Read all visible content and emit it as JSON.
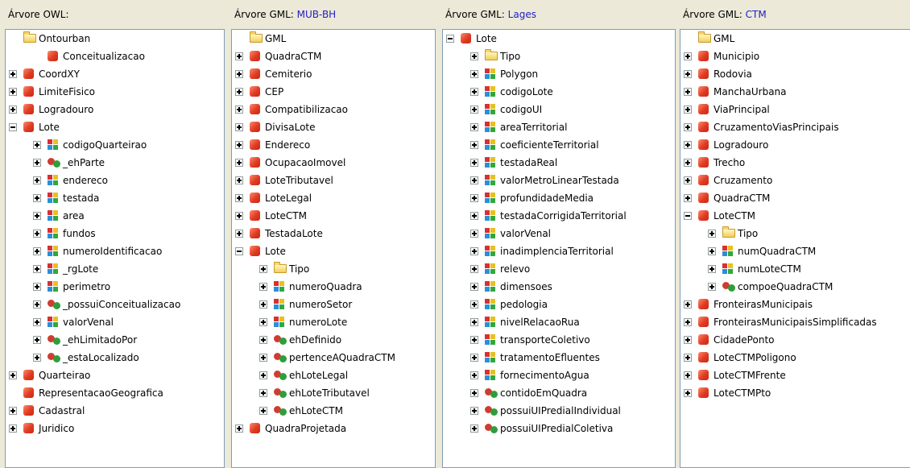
{
  "panels": [
    {
      "header": "Árvore OWL:",
      "source": "",
      "rows": [
        {
          "depth": 0,
          "toggle": "none",
          "icon": "folder",
          "label": "Ontourban"
        },
        {
          "depth": 1,
          "toggle": "none",
          "icon": "class",
          "label": "Conceitualizacao"
        },
        {
          "depth": 0,
          "toggle": "plus",
          "icon": "class",
          "label": "CoordXY"
        },
        {
          "depth": 0,
          "toggle": "plus",
          "icon": "class",
          "label": "LimiteFisico"
        },
        {
          "depth": 0,
          "toggle": "plus",
          "icon": "class",
          "label": "Logradouro"
        },
        {
          "depth": 0,
          "toggle": "minus",
          "icon": "class",
          "label": "Lote"
        },
        {
          "depth": 1,
          "toggle": "plus",
          "icon": "dt",
          "label": "codigoQuarteirao"
        },
        {
          "depth": 1,
          "toggle": "plus",
          "icon": "obj",
          "label": "_ehParte"
        },
        {
          "depth": 1,
          "toggle": "plus",
          "icon": "dt",
          "label": "endereco"
        },
        {
          "depth": 1,
          "toggle": "plus",
          "icon": "dt",
          "label": "testada"
        },
        {
          "depth": 1,
          "toggle": "plus",
          "icon": "dt",
          "label": "area"
        },
        {
          "depth": 1,
          "toggle": "plus",
          "icon": "dt",
          "label": "fundos"
        },
        {
          "depth": 1,
          "toggle": "plus",
          "icon": "dt",
          "label": "numeroIdentificacao"
        },
        {
          "depth": 1,
          "toggle": "plus",
          "icon": "dt",
          "label": "_rgLote"
        },
        {
          "depth": 1,
          "toggle": "plus",
          "icon": "dt",
          "label": "perimetro"
        },
        {
          "depth": 1,
          "toggle": "plus",
          "icon": "obj",
          "label": "_possuiConceitualizacao"
        },
        {
          "depth": 1,
          "toggle": "plus",
          "icon": "dt",
          "label": "valorVenal"
        },
        {
          "depth": 1,
          "toggle": "plus",
          "icon": "obj",
          "label": "_ehLimitadoPor"
        },
        {
          "depth": 1,
          "toggle": "plus",
          "icon": "obj",
          "label": "_estaLocalizado"
        },
        {
          "depth": 0,
          "toggle": "plus",
          "icon": "class",
          "label": "Quarteirao"
        },
        {
          "depth": 0,
          "toggle": "none",
          "icon": "class",
          "label": "RepresentacaoGeografica"
        },
        {
          "depth": 0,
          "toggle": "plus",
          "icon": "class",
          "label": "Cadastral"
        },
        {
          "depth": 0,
          "toggle": "plus",
          "icon": "class",
          "label": "Juridico"
        }
      ]
    },
    {
      "header": "Árvore GML:",
      "source": "MUB-BH",
      "rows": [
        {
          "depth": 0,
          "toggle": "none",
          "icon": "folder",
          "label": "GML"
        },
        {
          "depth": 0,
          "toggle": "plus",
          "icon": "class",
          "label": "QuadraCTM"
        },
        {
          "depth": 0,
          "toggle": "plus",
          "icon": "class",
          "label": "Cemiterio"
        },
        {
          "depth": 0,
          "toggle": "plus",
          "icon": "class",
          "label": "CEP"
        },
        {
          "depth": 0,
          "toggle": "plus",
          "icon": "class",
          "label": "Compatibilizacao"
        },
        {
          "depth": 0,
          "toggle": "plus",
          "icon": "class",
          "label": "DivisaLote"
        },
        {
          "depth": 0,
          "toggle": "plus",
          "icon": "class",
          "label": "Endereco"
        },
        {
          "depth": 0,
          "toggle": "plus",
          "icon": "class",
          "label": "OcupacaoImovel"
        },
        {
          "depth": 0,
          "toggle": "plus",
          "icon": "class",
          "label": "LoteTributavel"
        },
        {
          "depth": 0,
          "toggle": "plus",
          "icon": "class",
          "label": "LoteLegal"
        },
        {
          "depth": 0,
          "toggle": "plus",
          "icon": "class",
          "label": "LoteCTM"
        },
        {
          "depth": 0,
          "toggle": "plus",
          "icon": "class",
          "label": "TestadaLote"
        },
        {
          "depth": 0,
          "toggle": "minus",
          "icon": "class",
          "label": "Lote"
        },
        {
          "depth": 1,
          "toggle": "plus",
          "icon": "folder",
          "label": "Tipo"
        },
        {
          "depth": 1,
          "toggle": "plus",
          "icon": "dt",
          "label": "numeroQuadra"
        },
        {
          "depth": 1,
          "toggle": "plus",
          "icon": "dt",
          "label": "numeroSetor"
        },
        {
          "depth": 1,
          "toggle": "plus",
          "icon": "dt",
          "label": "numeroLote"
        },
        {
          "depth": 1,
          "toggle": "plus",
          "icon": "obj",
          "label": "ehDefinido"
        },
        {
          "depth": 1,
          "toggle": "plus",
          "icon": "obj",
          "label": "pertenceAQuadraCTM"
        },
        {
          "depth": 1,
          "toggle": "plus",
          "icon": "obj",
          "label": "ehLoteLegal"
        },
        {
          "depth": 1,
          "toggle": "plus",
          "icon": "obj",
          "label": "ehLoteTributavel"
        },
        {
          "depth": 1,
          "toggle": "plus",
          "icon": "obj",
          "label": "ehLoteCTM"
        },
        {
          "depth": 0,
          "toggle": "plus",
          "icon": "class",
          "label": "QuadraProjetada"
        }
      ]
    },
    {
      "header": "Árvore GML:",
      "source": "Lages",
      "rows": [
        {
          "depth": 0,
          "toggle": "minus",
          "icon": "class",
          "label": "Lote"
        },
        {
          "depth": 1,
          "toggle": "plus",
          "icon": "folder",
          "label": "Tipo"
        },
        {
          "depth": 1,
          "toggle": "plus",
          "icon": "dt",
          "label": "Polygon"
        },
        {
          "depth": 1,
          "toggle": "plus",
          "icon": "dt",
          "label": "codigoLote"
        },
        {
          "depth": 1,
          "toggle": "plus",
          "icon": "dt",
          "label": "codigoUI"
        },
        {
          "depth": 1,
          "toggle": "plus",
          "icon": "dt",
          "label": "areaTerritorial"
        },
        {
          "depth": 1,
          "toggle": "plus",
          "icon": "dt",
          "label": "coeficienteTerritorial"
        },
        {
          "depth": 1,
          "toggle": "plus",
          "icon": "dt",
          "label": "testadaReal"
        },
        {
          "depth": 1,
          "toggle": "plus",
          "icon": "dt",
          "label": "valorMetroLinearTestada"
        },
        {
          "depth": 1,
          "toggle": "plus",
          "icon": "dt",
          "label": "profundidadeMedia"
        },
        {
          "depth": 1,
          "toggle": "plus",
          "icon": "dt",
          "label": "testadaCorrigidaTerritorial"
        },
        {
          "depth": 1,
          "toggle": "plus",
          "icon": "dt",
          "label": "valorVenal"
        },
        {
          "depth": 1,
          "toggle": "plus",
          "icon": "dt",
          "label": "inadimplenciaTerritorial"
        },
        {
          "depth": 1,
          "toggle": "plus",
          "icon": "dt",
          "label": "relevo"
        },
        {
          "depth": 1,
          "toggle": "plus",
          "icon": "dt",
          "label": "dimensoes"
        },
        {
          "depth": 1,
          "toggle": "plus",
          "icon": "dt",
          "label": "pedologia"
        },
        {
          "depth": 1,
          "toggle": "plus",
          "icon": "dt",
          "label": "nivelRelacaoRua"
        },
        {
          "depth": 1,
          "toggle": "plus",
          "icon": "dt",
          "label": "transporteColetivo"
        },
        {
          "depth": 1,
          "toggle": "plus",
          "icon": "dt",
          "label": "tratamentoEfluentes"
        },
        {
          "depth": 1,
          "toggle": "plus",
          "icon": "dt",
          "label": "fornecimentoAgua"
        },
        {
          "depth": 1,
          "toggle": "plus",
          "icon": "obj",
          "label": "contidoEmQuadra"
        },
        {
          "depth": 1,
          "toggle": "plus",
          "icon": "obj",
          "label": "possuiUIPredialIndividual"
        },
        {
          "depth": 1,
          "toggle": "plus",
          "icon": "obj",
          "label": "possuiUIPredialColetiva"
        }
      ]
    },
    {
      "header": "Árvore GML:",
      "source": "CTM",
      "rows": [
        {
          "depth": 0,
          "toggle": "none",
          "icon": "folder",
          "label": "GML"
        },
        {
          "depth": 0,
          "toggle": "plus",
          "icon": "class",
          "label": "Municipio"
        },
        {
          "depth": 0,
          "toggle": "plus",
          "icon": "class",
          "label": "Rodovia"
        },
        {
          "depth": 0,
          "toggle": "plus",
          "icon": "class",
          "label": "ManchaUrbana"
        },
        {
          "depth": 0,
          "toggle": "plus",
          "icon": "class",
          "label": "ViaPrincipal"
        },
        {
          "depth": 0,
          "toggle": "plus",
          "icon": "class",
          "label": "CruzamentoViasPrincipais"
        },
        {
          "depth": 0,
          "toggle": "plus",
          "icon": "class",
          "label": "Logradouro"
        },
        {
          "depth": 0,
          "toggle": "plus",
          "icon": "class",
          "label": "Trecho"
        },
        {
          "depth": 0,
          "toggle": "plus",
          "icon": "class",
          "label": "Cruzamento"
        },
        {
          "depth": 0,
          "toggle": "plus",
          "icon": "class",
          "label": "QuadraCTM"
        },
        {
          "depth": 0,
          "toggle": "minus",
          "icon": "class",
          "label": "LoteCTM"
        },
        {
          "depth": 1,
          "toggle": "plus",
          "icon": "folder",
          "label": "Tipo"
        },
        {
          "depth": 1,
          "toggle": "plus",
          "icon": "dt",
          "label": "numQuadraCTM"
        },
        {
          "depth": 1,
          "toggle": "plus",
          "icon": "dt",
          "label": "numLoteCTM"
        },
        {
          "depth": 1,
          "toggle": "plus",
          "icon": "obj",
          "label": "compoeQuadraCTM"
        },
        {
          "depth": 0,
          "toggle": "plus",
          "icon": "class",
          "label": "FronteirasMunicipais"
        },
        {
          "depth": 0,
          "toggle": "plus",
          "icon": "class",
          "label": "FronteirasMunicipaisSimplificadas"
        },
        {
          "depth": 0,
          "toggle": "plus",
          "icon": "class",
          "label": "CidadePonto"
        },
        {
          "depth": 0,
          "toggle": "plus",
          "icon": "class",
          "label": "LoteCTMPoligono"
        },
        {
          "depth": 0,
          "toggle": "plus",
          "icon": "class",
          "label": "LoteCTMFrente"
        },
        {
          "depth": 0,
          "toggle": "plus",
          "icon": "class",
          "label": "LoteCTMPto"
        }
      ]
    }
  ]
}
